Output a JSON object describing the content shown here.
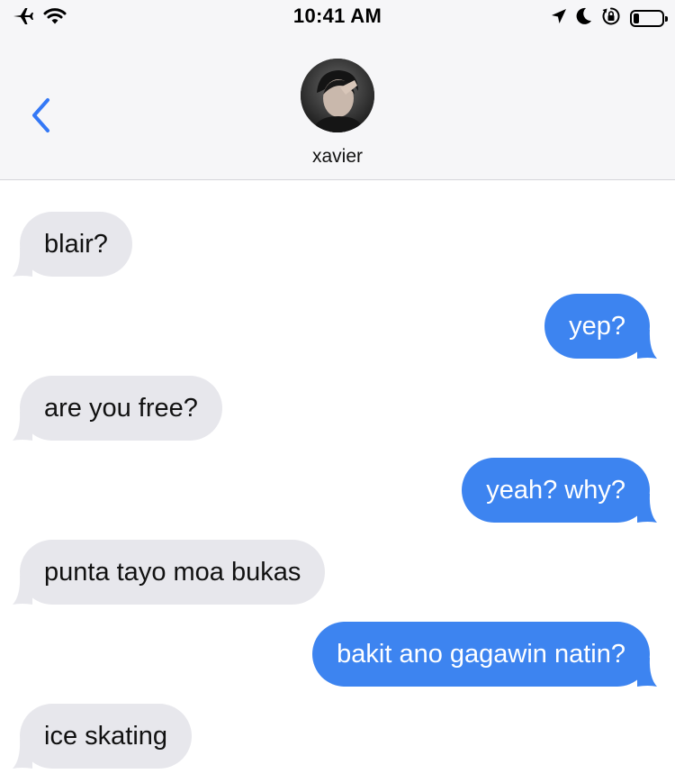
{
  "status_bar": {
    "time": "10:41 AM",
    "icons": [
      "airplane-icon",
      "wifi-icon",
      "location-icon",
      "moon-icon",
      "rotation-lock-icon",
      "battery-icon"
    ]
  },
  "header": {
    "back_icon": "chevron-left-icon",
    "contact_name": "xavier"
  },
  "colors": {
    "incoming_bubble": "#e7e7ec",
    "outgoing_bubble": "#3d84f0",
    "accent": "#3478f6"
  },
  "messages": [
    {
      "direction": "incoming",
      "text": "blair?"
    },
    {
      "direction": "outgoing",
      "text": "yep?"
    },
    {
      "direction": "incoming",
      "text": "are you free?"
    },
    {
      "direction": "outgoing",
      "text": "yeah? why?"
    },
    {
      "direction": "incoming",
      "text": "punta tayo moa bukas"
    },
    {
      "direction": "outgoing",
      "text": "bakit ano gagawin natin?"
    },
    {
      "direction": "incoming",
      "text": "ice skating"
    }
  ]
}
